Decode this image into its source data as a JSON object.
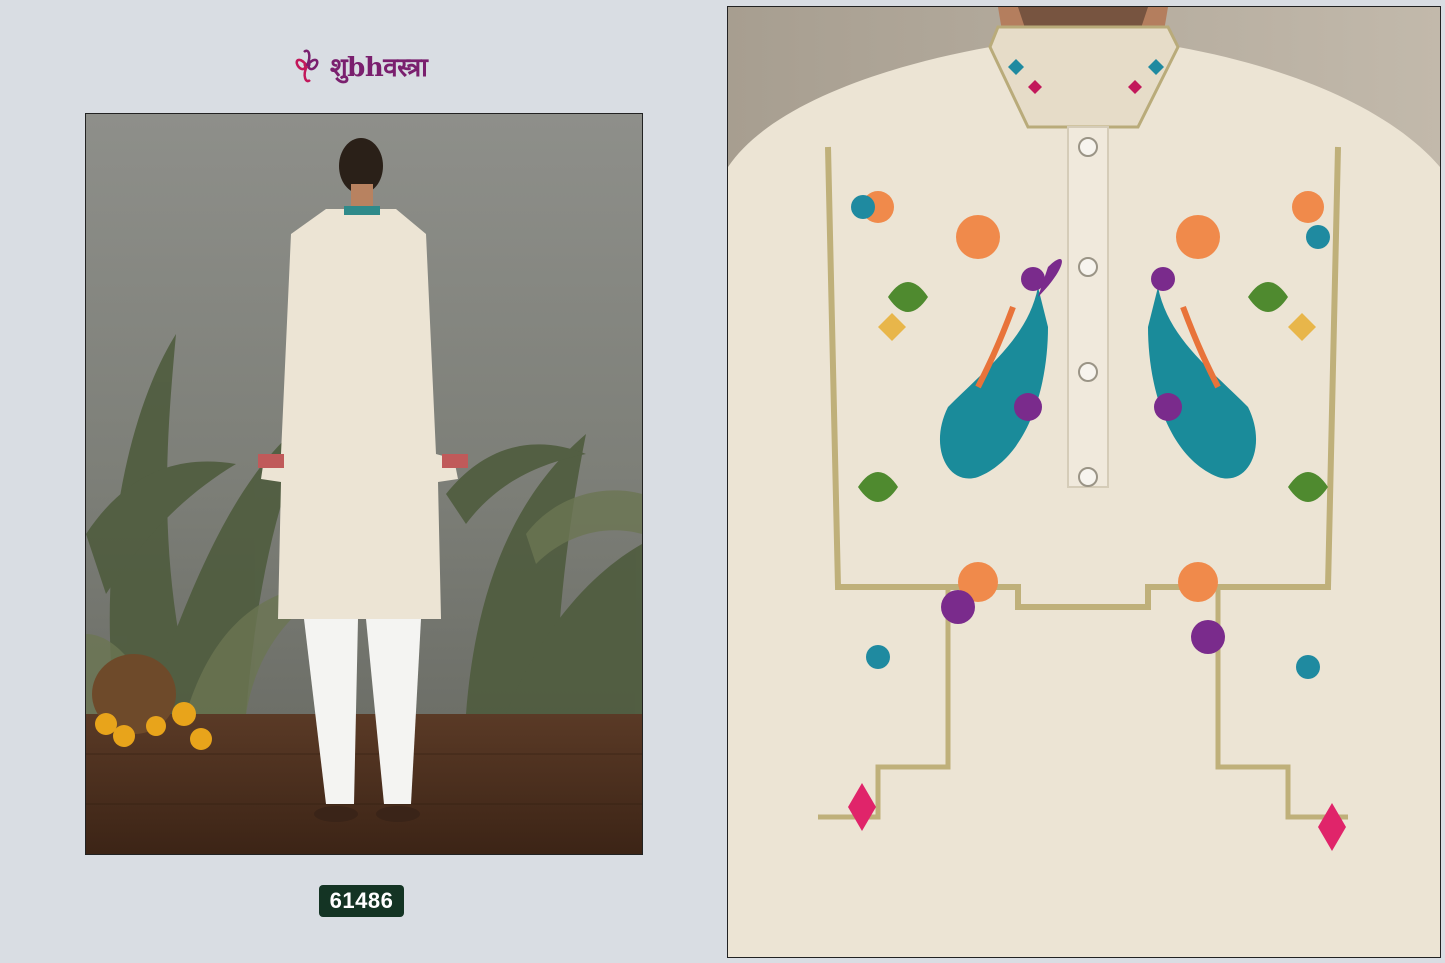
{
  "brand": {
    "logo_text": "शुbhवस्त्रा",
    "logo_icon": "swirl-logo-icon",
    "colors": {
      "logo": "#7a1f6e",
      "logo_accent": "#c2185b"
    }
  },
  "product": {
    "design_code": "61486"
  },
  "images": {
    "back_view": "model-back-view-photo",
    "front_view": "embroidered-kurta-closeup-photo"
  },
  "colors": {
    "background": "#d9dde3",
    "badge": "#143424",
    "kurta": "#ece4d4"
  }
}
